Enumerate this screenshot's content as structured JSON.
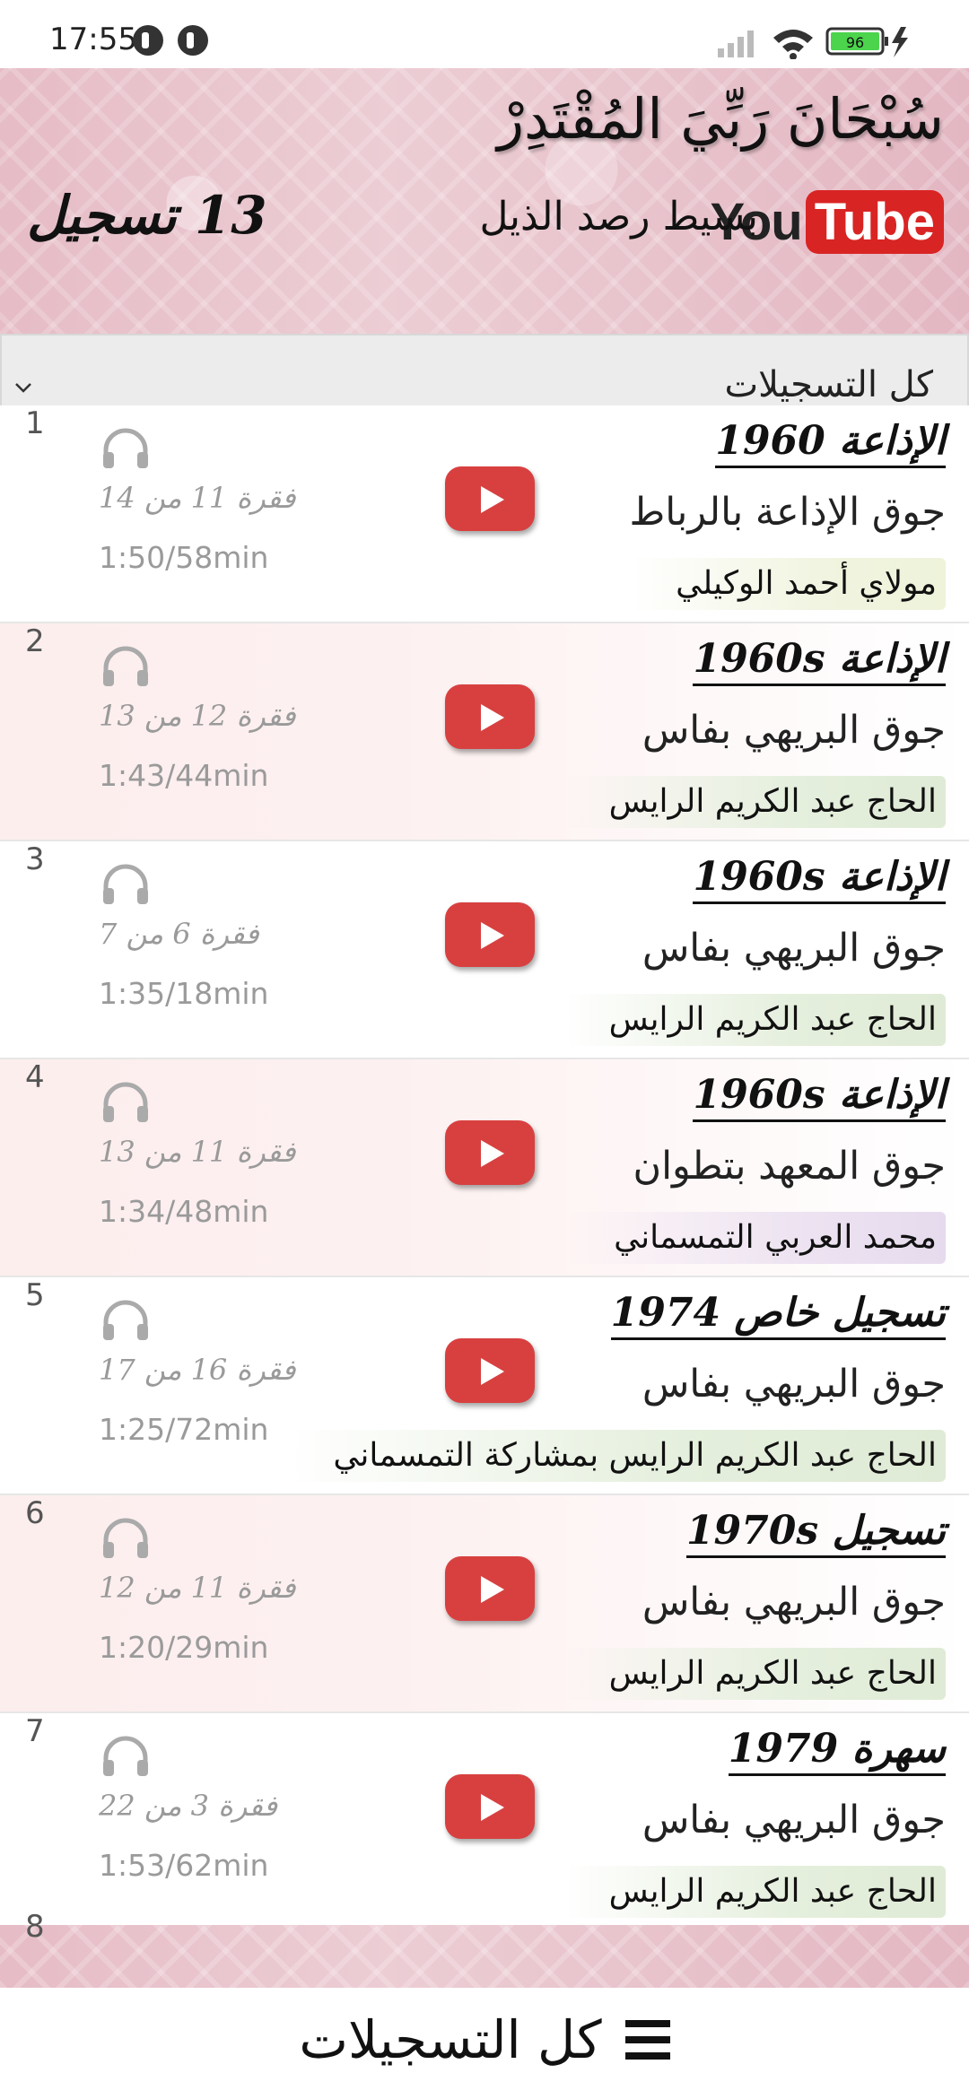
{
  "status_bar": {
    "time": "17:55",
    "battery": "96"
  },
  "header": {
    "title": "سُبْحَانَ رَبِّيَ المُقْتَدِرْ",
    "youtube_you": "You",
    "youtube_tube": "Tube",
    "subtitle": "بسيط رصد الذيل",
    "count": "13 تسجيل"
  },
  "filter": {
    "selected": "كل التسجيلات"
  },
  "recordings": [
    {
      "index": "1",
      "title": "الإذاعة 1960",
      "orchestra": "جوق الإذاعة بالرباط",
      "singer": "مولاي أحمد الوكيلي",
      "track": "فقرة 11 من 14",
      "duration": "1:50/58min"
    },
    {
      "index": "2",
      "title": "الإذاعة 1960s",
      "orchestra": "جوق البريهي بفاس",
      "singer": "الحاج عبد الكريم الرايس",
      "track": "فقرة 12 من 13",
      "duration": "1:43/44min"
    },
    {
      "index": "3",
      "title": "الإذاعة 1960s",
      "orchestra": "جوق البريهي بفاس",
      "singer": "الحاج عبد الكريم الرايس",
      "track": "فقرة 6 من 7",
      "duration": "1:35/18min"
    },
    {
      "index": "4",
      "title": "الإذاعة 1960s",
      "orchestra": "جوق المعهد بتطوان",
      "singer": "محمد العربي التمسماني",
      "track": "فقرة 11 من 13",
      "duration": "1:34/48min"
    },
    {
      "index": "5",
      "title": "تسجيل خاص 1974",
      "orchestra": "جوق البريهي بفاس",
      "singer": "الحاج عبد الكريم الرايس بمشاركة التمسماني",
      "track": "فقرة 16 من 17",
      "duration": "1:25/72min"
    },
    {
      "index": "6",
      "title": "تسجيل 1970s",
      "orchestra": "جوق البريهي بفاس",
      "singer": "الحاج عبد الكريم الرايس",
      "track": "فقرة 11 من 12",
      "duration": "1:20/29min"
    },
    {
      "index": "7",
      "title": "سهرة 1979",
      "orchestra": "جوق البريهي بفاس",
      "singer": "الحاج عبد الكريم الرايس",
      "track": "فقرة 3 من 22",
      "duration": "1:53/62min"
    }
  ],
  "partial_row_index": "8",
  "bottom_nav": {
    "label": "كل التسجيلات"
  },
  "colors": {
    "header_pink": "#e6bcc6",
    "play_red": "#d84040",
    "youtube_red": "#d92424",
    "alt_row": "#fdeeee"
  },
  "icons": [
    "headphones-icon",
    "play-icon",
    "chevron-down-icon",
    "menu-icon",
    "signal-icon",
    "wifi-icon",
    "battery-icon",
    "charging-icon"
  ]
}
